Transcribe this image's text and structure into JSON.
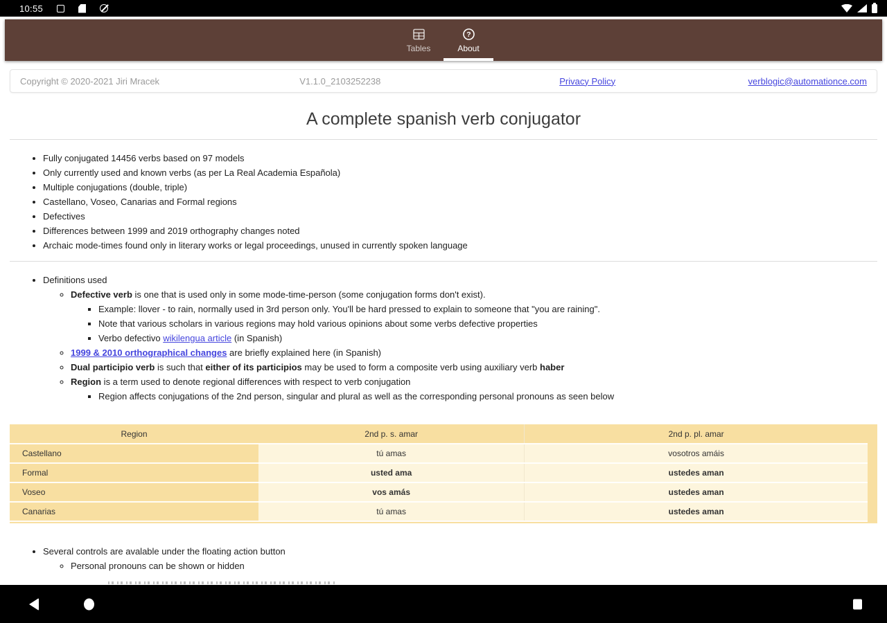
{
  "status_bar": {
    "time": "10:55",
    "left_icons": [
      "screenshot-icon",
      "sdcard-icon",
      "circle-slash-icon"
    ],
    "right_icons": [
      "wifi-icon",
      "signal-icon",
      "battery-icon"
    ]
  },
  "app_bar": {
    "color": "#5d4037",
    "tabs": [
      {
        "label": "Tables",
        "icon": "table-icon",
        "active": false
      },
      {
        "label": "About",
        "icon": "help-icon",
        "active": true
      }
    ]
  },
  "info_bar": {
    "copyright": "Copyright © 2020-2021 Jiri Mracek",
    "version": "V1.1.0_2103252238",
    "privacy_link": "Privacy Policy",
    "email_link": "verblogic@automationce.com"
  },
  "about": {
    "title": "A complete spanish verb conjugator",
    "features": [
      "Fully conjugated 14456 verbs based on 97 models",
      "Only currently used and known verbs (as per La Real Academia Española)",
      "Multiple conjugations (double, triple)",
      "Castellano, Voseo, Canarias and Formal regions",
      "Defectives",
      "Differences between 1999 and 2019 orthography changes noted",
      "Archaic mode-times found only in literary works or legal proceedings, unused in currently spoken language"
    ],
    "definitions": [
      {
        "segments": [
          {
            "t": "Definitions used"
          }
        ],
        "children": [
          {
            "segments": [
              {
                "t": "Defective verb",
                "b": true
              },
              {
                "t": " is one that is used only in some mode-time-person (some conjugation forms don't exist)."
              }
            ],
            "children": [
              {
                "segments": [
                  {
                    "t": "Example: llover - to rain, normally used in 3rd person only. You'll be hard pressed to explain to someone that \"you are raining\"."
                  }
                ]
              },
              {
                "segments": [
                  {
                    "t": "Note that various scholars in various regions may hold various opinions about some verbs defective properties"
                  }
                ]
              },
              {
                "segments": [
                  {
                    "t": "Verbo defectivo "
                  },
                  {
                    "t": "wikilengua article",
                    "a": true
                  },
                  {
                    "t": " (in Spanish)"
                  }
                ]
              }
            ]
          },
          {
            "segments": [
              {
                "t": "1999 & 2010 orthographical changes",
                "a": true,
                "b": true
              },
              {
                "t": " are briefly explained here (in Spanish)"
              }
            ]
          },
          {
            "segments": [
              {
                "t": "Dual participio verb",
                "b": true
              },
              {
                "t": " is such that "
              },
              {
                "t": "either of its participios",
                "b": true
              },
              {
                "t": " may be used to form a composite verb using auxiliary verb "
              },
              {
                "t": "haber",
                "b": true
              }
            ]
          },
          {
            "segments": [
              {
                "t": "Region",
                "b": true
              },
              {
                "t": " is a term used to denote regional differences with respect to verb conjugation"
              }
            ],
            "children": [
              {
                "segments": [
                  {
                    "t": "Region affects conjugations of the 2nd person, singular and plural as well as the corresponding personal pronouns as seen below"
                  }
                ]
              }
            ]
          }
        ]
      }
    ],
    "regions_table": {
      "headers": [
        "Region",
        "2nd p. s. amar",
        "2nd p. pl. amar"
      ],
      "rows": [
        {
          "cells": [
            {
              "t": "Castellano"
            },
            {
              "t": "tú amas"
            },
            {
              "t": "vosotros amáis"
            }
          ]
        },
        {
          "cells": [
            {
              "t": "Formal"
            },
            {
              "t": "usted ama",
              "b": true
            },
            {
              "t": "ustedes aman",
              "b": true
            }
          ]
        },
        {
          "cells": [
            {
              "t": "Voseo"
            },
            {
              "t": "vos amás",
              "b": true
            },
            {
              "t": "ustedes aman",
              "b": true
            }
          ]
        },
        {
          "cells": [
            {
              "t": "Canarias"
            },
            {
              "t": "tú amas"
            },
            {
              "t": "ustedes aman",
              "b": true
            }
          ]
        }
      ],
      "header_bg": "#f8dfa1",
      "cell_bg": "#fdf5dd"
    },
    "controls": [
      {
        "segments": [
          {
            "t": "Several controls are avalable under the floating action button"
          }
        ],
        "children": [
          {
            "segments": [
              {
                "t": "Personal pronouns can be shown or hidden"
              }
            ]
          }
        ]
      }
    ]
  },
  "nav_bar": {
    "buttons": [
      "back",
      "home",
      "recents"
    ]
  }
}
